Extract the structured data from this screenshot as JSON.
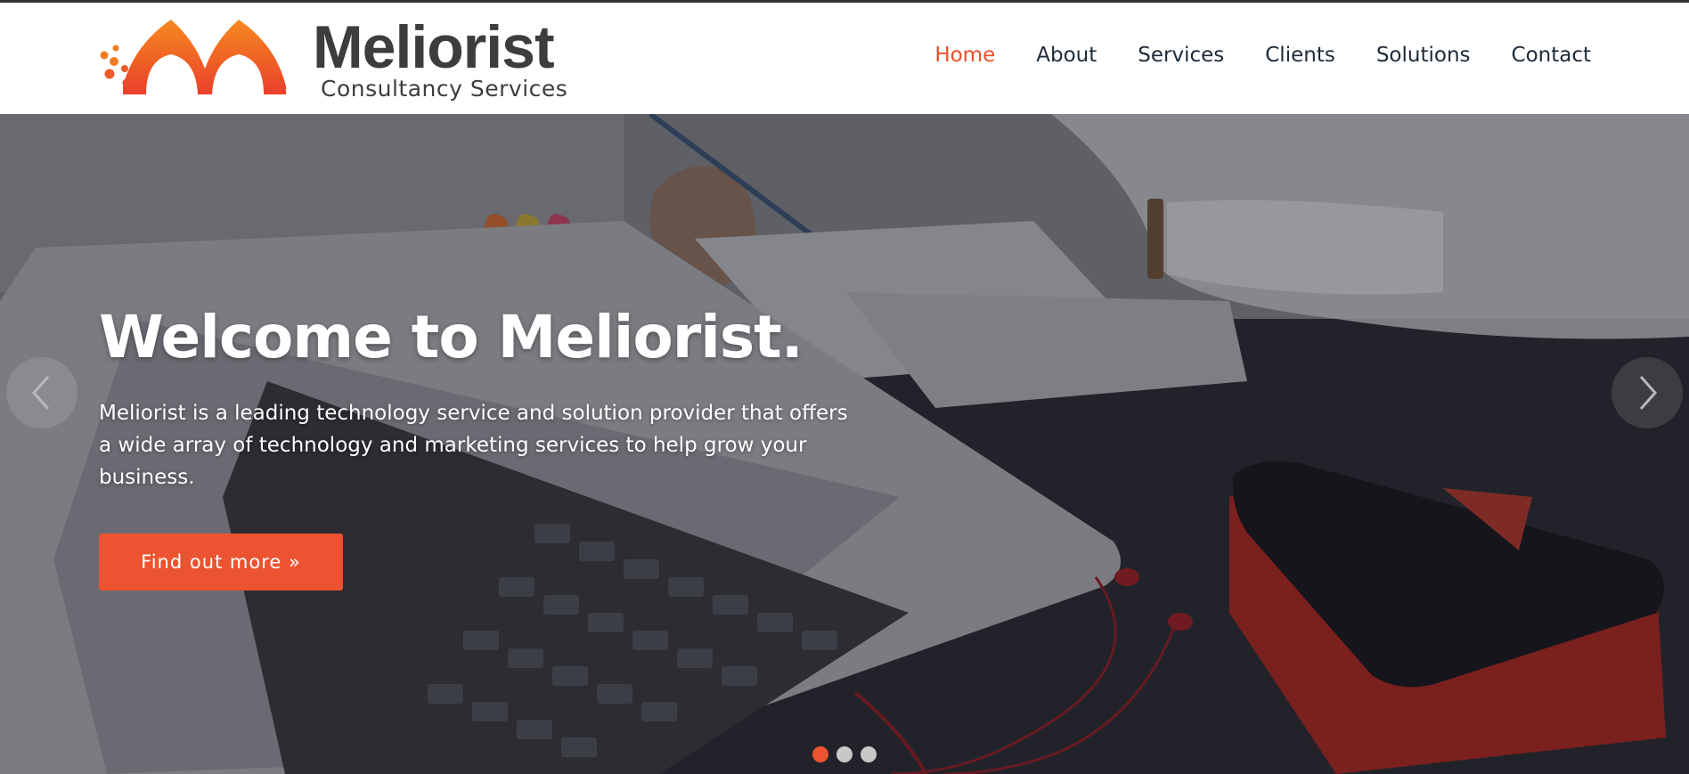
{
  "brand": {
    "name": "Meliorist",
    "tagline": "Consultancy Services",
    "colors": {
      "orange": "#f47a20",
      "red": "#e8432a",
      "text": "#3d3d3d"
    }
  },
  "nav": {
    "items": [
      {
        "label": "Home",
        "active": true
      },
      {
        "label": "About"
      },
      {
        "label": "Services"
      },
      {
        "label": "Clients"
      },
      {
        "label": "Solutions"
      },
      {
        "label": "Contact"
      }
    ],
    "active_color": "#e8502a"
  },
  "hero": {
    "title": "Welcome to Meliorist.",
    "description": "Meliorist is a leading technology service and solution provider that offers a wide array of technology and marketing services to help grow your business.",
    "cta_label": "Find out more »",
    "cta_color": "#ec5330",
    "prev_icon": "chevron-left-icon",
    "next_icon": "chevron-right-icon",
    "slides_count": 3,
    "active_slide": 1
  }
}
